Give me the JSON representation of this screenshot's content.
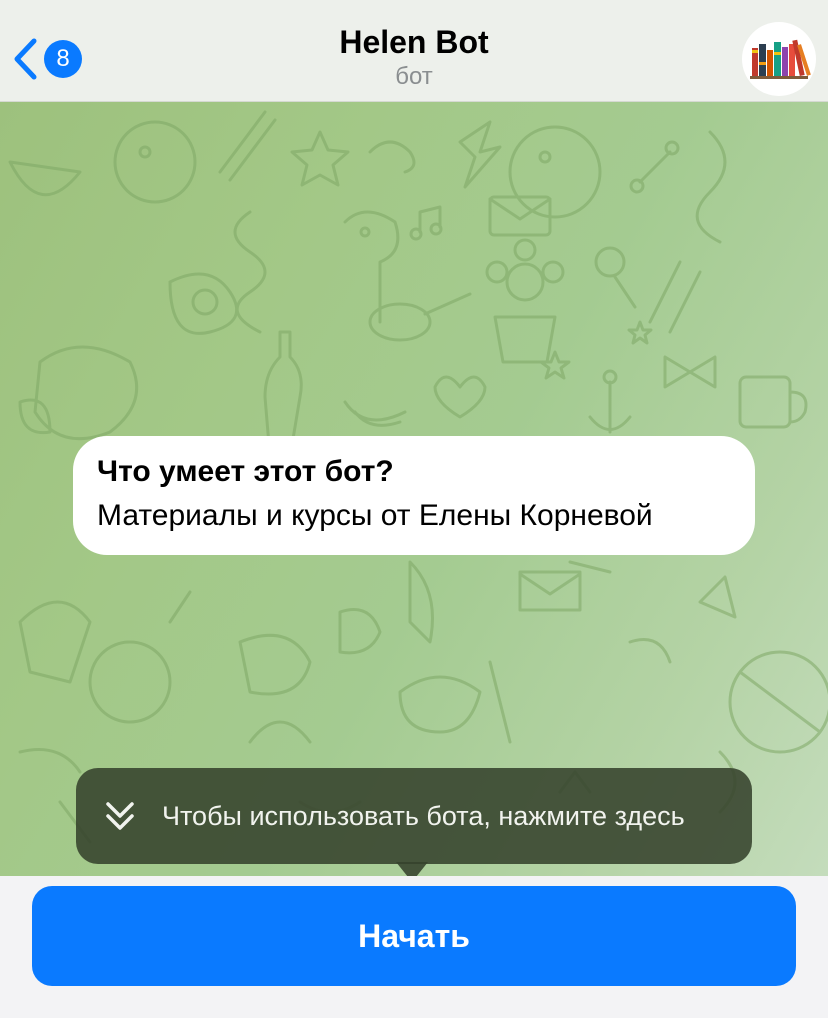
{
  "header": {
    "back_badge": "8",
    "title": "Helen Bot",
    "subtitle": "бот"
  },
  "bot_info": {
    "title": "Что умеет этот бот?",
    "description": "Материалы и курсы от Елены Корневой"
  },
  "tooltip": {
    "text": "Чтобы использовать бота, нажмите здесь",
    "icon": "double-chevron-down-icon"
  },
  "start_button": {
    "label": "Начать"
  },
  "colors": {
    "accent": "#0a7aff",
    "chat_background": "#a4cb91",
    "tooltip_background": "#36422c"
  },
  "icons": {
    "back": "chevron-left-icon",
    "avatar": "bookshelf-avatar-icon"
  }
}
